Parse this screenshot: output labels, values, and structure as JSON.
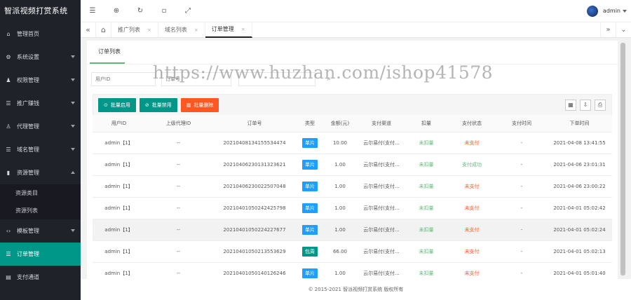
{
  "brand": "智派视频打赏系统",
  "sidebar": {
    "items": [
      {
        "icon": "home-icon",
        "glyph": "⌂",
        "label": "管理首页",
        "arrow": false
      },
      {
        "icon": "gear-icon",
        "glyph": "⚙",
        "label": "系统设置",
        "arrow": true
      },
      {
        "icon": "user-group-icon",
        "glyph": "♟",
        "label": "权限管理",
        "arrow": true
      },
      {
        "icon": "list-icon",
        "glyph": "☰",
        "label": "推广赚钱",
        "arrow": true
      },
      {
        "icon": "agent-icon",
        "glyph": "♙",
        "label": "代理管理",
        "arrow": true
      },
      {
        "icon": "list-icon",
        "glyph": "☰",
        "label": "域名管理",
        "arrow": true
      },
      {
        "icon": "resource-icon",
        "glyph": "▮",
        "label": "资源管理",
        "arrow": true,
        "expanded": true
      }
    ],
    "sub_items": [
      "资源类目",
      "资源列表"
    ],
    "items_after": [
      {
        "icon": "template-icon",
        "glyph": "‹›",
        "label": "模板管理",
        "arrow": true,
        "active": false
      },
      {
        "icon": "list-icon",
        "glyph": "☰",
        "label": "订单管理",
        "arrow": false,
        "active": true
      },
      {
        "icon": "pay-icon",
        "glyph": "▤",
        "label": "支付通道",
        "arrow": false,
        "active": false
      }
    ]
  },
  "topbar": {
    "icons": [
      {
        "name": "menu-toggle-icon",
        "glyph": "☰"
      },
      {
        "name": "globe-icon",
        "glyph": "⊕"
      },
      {
        "name": "refresh-icon",
        "glyph": "↻"
      },
      {
        "name": "theme-icon",
        "glyph": "▫"
      },
      {
        "name": "fullscreen-icon",
        "glyph": "⤢"
      }
    ],
    "user": "admin"
  },
  "tabs": [
    {
      "label": "推广列表",
      "close": "×"
    },
    {
      "label": "域名列表",
      "close": "×"
    },
    {
      "label": "订单管理",
      "close": "×",
      "active": true
    }
  ],
  "page": {
    "title": "订单列表",
    "search_placeholder_1": "用户ID",
    "search_placeholder_2": "订单号"
  },
  "toolbar": {
    "enable_label": "批量启用",
    "disable_label": "批量禁用",
    "delete_label": "批量删除"
  },
  "table": {
    "headers": [
      "用户ID",
      "上级代理ID",
      "订单号",
      "类型",
      "金额(元)",
      "支付渠道",
      "扣量",
      "支付状态",
      "支付时间",
      "下单时间"
    ],
    "rows": [
      {
        "user": "admin【1】",
        "agent": "--",
        "order": "20210408134155534474",
        "type": "单片",
        "type_color": "#1e9fff",
        "amount": "10.00",
        "channel": "云尔易付(支付...",
        "deduct": "未扣量",
        "status": "未支付",
        "status_color": "#ff5722",
        "paytime": "-",
        "created": "2021-04-08 13:41:55",
        "hl": false
      },
      {
        "user": "admin【1】",
        "agent": "--",
        "order": "20210406230131323621",
        "type": "单片",
        "type_color": "#1e9fff",
        "amount": "1.00",
        "channel": "云尔易付(支付...",
        "deduct": "未扣量",
        "status": "支付成功",
        "status_color": "#5fb878",
        "paytime": "-",
        "created": "2021-04-06 23:01:31",
        "hl": false
      },
      {
        "user": "admin【1】",
        "agent": "--",
        "order": "20210406230022507048",
        "type": "单片",
        "type_color": "#1e9fff",
        "amount": "1.00",
        "channel": "云尔易付(支付...",
        "deduct": "未扣量",
        "status": "未支付",
        "status_color": "#ff5722",
        "paytime": "-",
        "created": "2021-04-06 23:00:22",
        "hl": false
      },
      {
        "user": "admin【1】",
        "agent": "--",
        "order": "20210401050242425798",
        "type": "单片",
        "type_color": "#1e9fff",
        "amount": "1.00",
        "channel": "云尔易付(支付...",
        "deduct": "未扣量",
        "status": "未支付",
        "status_color": "#ff5722",
        "paytime": "-",
        "created": "2021-04-01 05:02:42",
        "hl": false
      },
      {
        "user": "admin【1】",
        "agent": "--",
        "order": "20210401050224227677",
        "type": "单片",
        "type_color": "#1e9fff",
        "amount": "1.00",
        "channel": "云尔易付(支付...",
        "deduct": "未扣量",
        "status": "未支付",
        "status_color": "#ff5722",
        "paytime": "-",
        "created": "2021-04-01 05:02:24",
        "hl": true
      },
      {
        "user": "admin【1】",
        "agent": "--",
        "order": "20210401050213553629",
        "type": "包周",
        "type_color": "#009688",
        "amount": "66.00",
        "channel": "云尔易付(支付...",
        "deduct": "未扣量",
        "status": "未支付",
        "status_color": "#ff5722",
        "paytime": "-",
        "created": "2021-04-01 05:02:13",
        "hl": false
      },
      {
        "user": "admin【1】",
        "agent": "--",
        "order": "20210401050140126246",
        "type": "单片",
        "type_color": "#1e9fff",
        "amount": "1.00",
        "channel": "云尔易付(支付...",
        "deduct": "未扣量",
        "status": "未支付",
        "status_color": "#ff5722",
        "paytime": "-",
        "created": "2021-04-01 05:01:40",
        "hl": false
      }
    ]
  },
  "footer": "© 2015-2021 智派视频打赏系统 版权所有",
  "watermark": "https://www.huzhan.com/ishop41578"
}
